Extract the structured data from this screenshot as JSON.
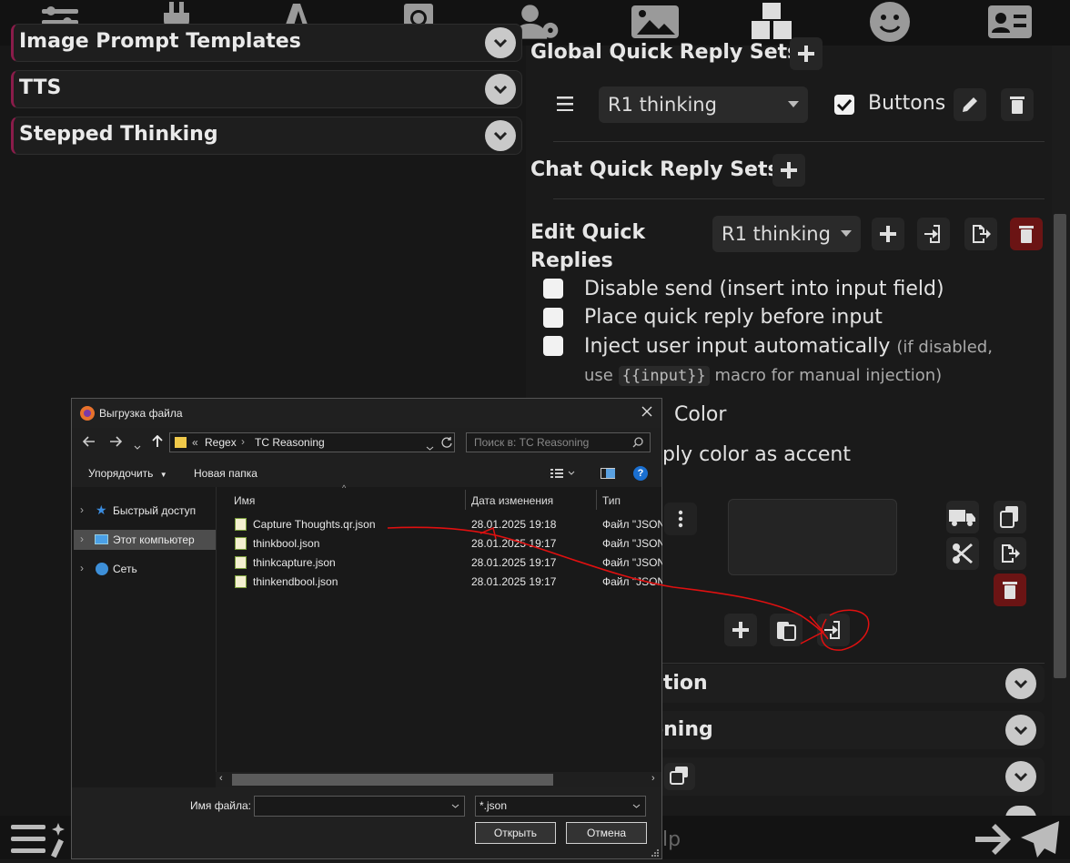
{
  "left": {
    "drawers": [
      "Image Prompt Templates",
      "TTS",
      "Stepped Thinking"
    ]
  },
  "right": {
    "global_title": "Global Quick Reply Sets",
    "global_set_select": "R1 thinking",
    "buttons_label": "Buttons",
    "chat_title": "Chat Quick Reply Sets",
    "edit_title_line1": "Edit Quick",
    "edit_title_line2": "Replies",
    "edit_set_select": "R1 thinking",
    "opt_disable_send": "Disable send (insert into input field)",
    "opt_place_before": "Place quick reply before input",
    "opt_inject": "Inject user input automatically",
    "opt_inject_hint1": "(if disabled,",
    "opt_inject_hint2_a": "use",
    "opt_inject_code": "{{input}}",
    "opt_inject_hint2_b": "macro for manual injection)",
    "color_label": "Color",
    "accent_label": "ply color as accent",
    "drawer_partial_1": "ation",
    "drawer_partial_2": "oning",
    "input_placeholder_partial": "lp"
  },
  "dialog": {
    "title": "Выгрузка файла",
    "path": [
      "Regex",
      "TC Reasoning"
    ],
    "path_prefix": "«",
    "search_placeholder": "Поиск в: TC Reasoning",
    "organize": "Упорядочить",
    "new_folder": "Новая папка",
    "nav_items": [
      "Быстрый доступ",
      "Этот компьютер",
      "Сеть"
    ],
    "columns": [
      "Имя",
      "Дата изменения",
      "Тип"
    ],
    "files": [
      {
        "name": "Capture Thoughts.qr.json",
        "date": "28.01.2025 19:18",
        "type": "Файл \"JSON"
      },
      {
        "name": "thinkbool.json",
        "date": "28.01.2025 19:17",
        "type": "Файл \"JSON"
      },
      {
        "name": "thinkcapture.json",
        "date": "28.01.2025 19:17",
        "type": "Файл \"JSON"
      },
      {
        "name": "thinkendbool.json",
        "date": "28.01.2025 19:17",
        "type": "Файл \"JSON"
      }
    ],
    "filename_label": "Имя файла:",
    "filename_value": "",
    "filter_value": "*.json",
    "open_button": "Открыть",
    "cancel_button": "Отмена"
  },
  "colors": {
    "accent": "#8a1c4a",
    "annotation": "#e01010",
    "delete_red": "#6b1414"
  }
}
